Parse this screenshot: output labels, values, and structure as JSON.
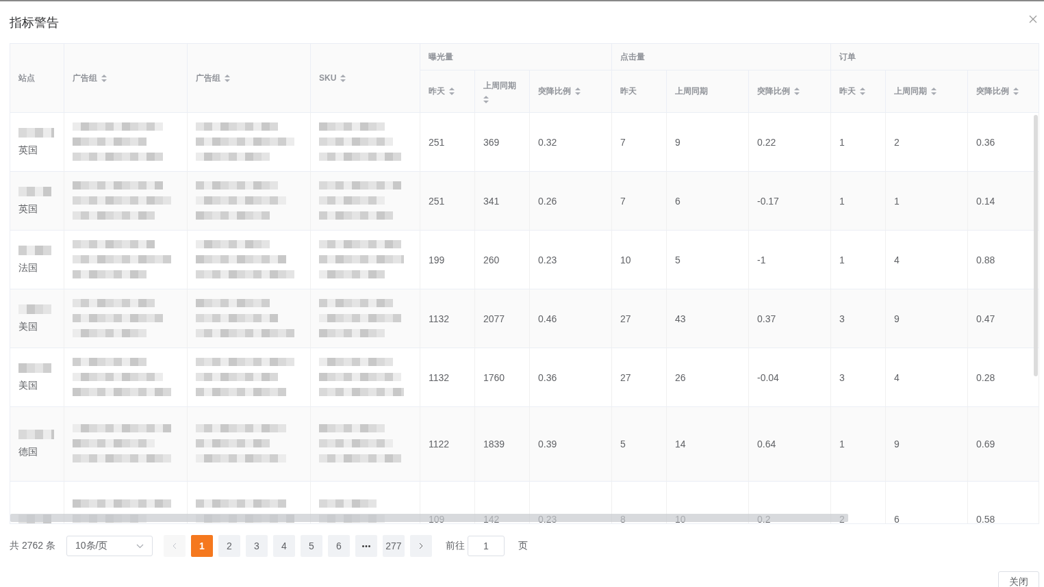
{
  "dialog": {
    "title": "指标警告"
  },
  "table": {
    "fixed_columns": [
      {
        "label": "站点",
        "sortable": false
      },
      {
        "label": "广告组",
        "sortable": true
      },
      {
        "label": "广告组",
        "sortable": true
      },
      {
        "label": "SKU",
        "sortable": true
      }
    ],
    "groups": [
      {
        "label": "曝光量",
        "columns": [
          {
            "label": "昨天",
            "sortable": true
          },
          {
            "label": "上周同期",
            "sortable": true
          },
          {
            "label": "突降比例",
            "sortable": true
          }
        ]
      },
      {
        "label": "点击量",
        "columns": [
          {
            "label": "昨天",
            "sortable": false
          },
          {
            "label": "上周同期",
            "sortable": false
          },
          {
            "label": "突降比例",
            "sortable": true
          }
        ]
      },
      {
        "label": "订单",
        "columns": [
          {
            "label": "昨天",
            "sortable": true
          },
          {
            "label": "上周同期",
            "sortable": true
          },
          {
            "label": "突降比例",
            "sortable": true
          }
        ]
      }
    ],
    "rows": [
      {
        "site": "英国",
        "values": [
          "251",
          "369",
          "0.32",
          "7",
          "9",
          "0.22",
          "1",
          "2",
          "0.36"
        ]
      },
      {
        "site": "英国",
        "values": [
          "251",
          "341",
          "0.26",
          "7",
          "6",
          "-0.17",
          "1",
          "1",
          "0.14"
        ]
      },
      {
        "site": "法国",
        "values": [
          "199",
          "260",
          "0.23",
          "10",
          "5",
          "-1",
          "1",
          "4",
          "0.88"
        ]
      },
      {
        "site": "美国",
        "values": [
          "1132",
          "2077",
          "0.46",
          "27",
          "43",
          "0.37",
          "3",
          "9",
          "0.47"
        ]
      },
      {
        "site": "美国",
        "values": [
          "1132",
          "1760",
          "0.36",
          "27",
          "26",
          "-0.04",
          "3",
          "4",
          "0.28"
        ]
      },
      {
        "site": "德国",
        "values": [
          "1122",
          "1839",
          "0.39",
          "5",
          "14",
          "0.64",
          "1",
          "9",
          "0.69"
        ]
      },
      {
        "values": [
          "109",
          "142",
          "0.23",
          "8",
          "10",
          "0.2",
          "2",
          "6",
          "0.58"
        ]
      }
    ]
  },
  "pagination": {
    "total": "共 2762 条",
    "page_size": "10条/页",
    "pages": [
      {
        "kind": "page",
        "label": "1",
        "selected": true
      },
      {
        "kind": "page",
        "label": "2",
        "selected": false
      },
      {
        "kind": "page",
        "label": "3",
        "selected": false
      },
      {
        "kind": "page",
        "label": "4",
        "selected": false
      },
      {
        "kind": "page",
        "label": "5",
        "selected": false
      },
      {
        "kind": "page",
        "label": "6",
        "selected": false
      },
      {
        "kind": "more"
      },
      {
        "kind": "page",
        "label": "277",
        "selected": false
      }
    ],
    "goto_label": "前往",
    "goto_value": "1",
    "goto_unit": "页"
  },
  "footer": {
    "close_button": "关闭"
  }
}
